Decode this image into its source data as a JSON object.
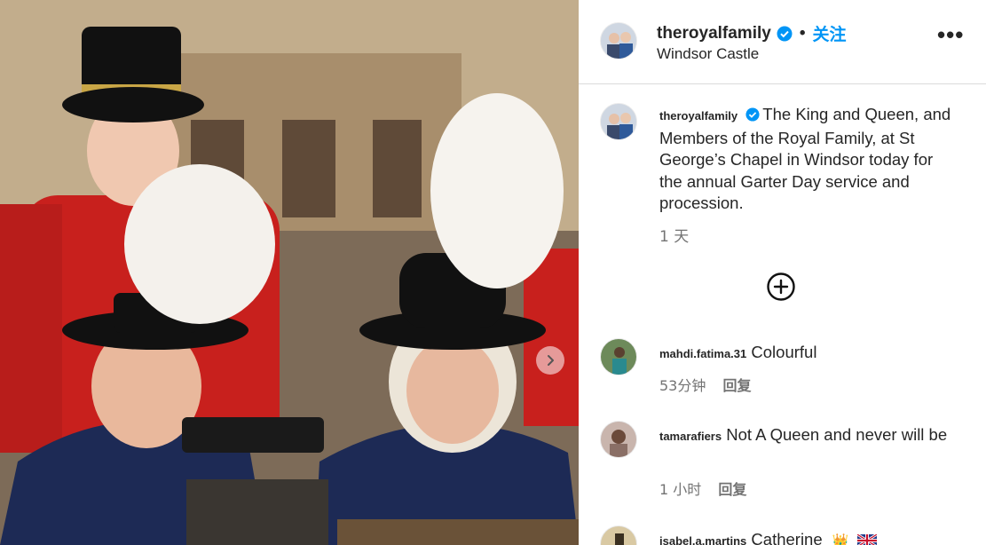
{
  "post": {
    "author": "theroyalfamily",
    "follow_label": "关注",
    "separator": "•",
    "location": "Windsor Castle",
    "more_icon": "•••"
  },
  "caption": {
    "user": "theroyalfamily",
    "text": "The King and Queen, and Members of the Royal Family, at St George’s Chapel in Windsor today for the annual Garter Day service and procession.",
    "time": "1 天"
  },
  "comments": [
    {
      "user": "mahdi.fatima.31",
      "text": "Colourful",
      "time": "53分钟",
      "reply": "回复"
    },
    {
      "user": "tamarafiers",
      "text": "Not A Queen and never will be",
      "time": "1 小时",
      "reply": "回复"
    },
    {
      "user": "isabel.a.martins",
      "text": "Catherine",
      "emoji": "👑"
    }
  ],
  "colors": {
    "accent": "#0095f6",
    "verified": "#0095f6",
    "muted": "#737373"
  }
}
